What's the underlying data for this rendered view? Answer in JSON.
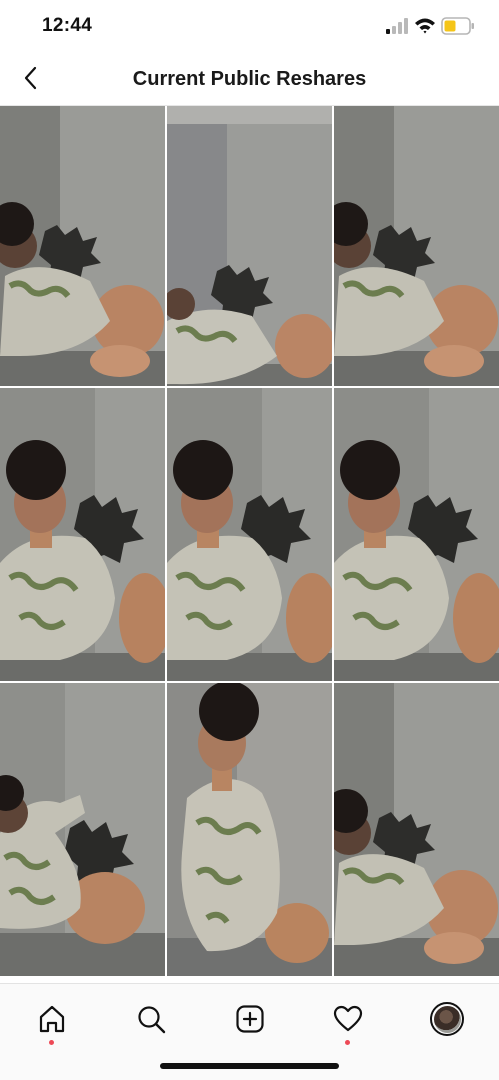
{
  "status_bar": {
    "time": "12:44",
    "battery_color": "#f5c518"
  },
  "header": {
    "title": "Current Public Reshares",
    "back_icon": "chevron-left-icon"
  },
  "grid": {
    "columns": 3,
    "tiles": [
      {
        "label": "reshare-1",
        "pose": "lying"
      },
      {
        "label": "reshare-2",
        "pose": "lying-low"
      },
      {
        "label": "reshare-3",
        "pose": "lying"
      },
      {
        "label": "reshare-4",
        "pose": "sitting"
      },
      {
        "label": "reshare-5",
        "pose": "sitting"
      },
      {
        "label": "reshare-6",
        "pose": "sitting"
      },
      {
        "label": "reshare-7",
        "pose": "arm-up"
      },
      {
        "label": "reshare-8",
        "pose": "kneeling"
      },
      {
        "label": "reshare-9",
        "pose": "lying"
      }
    ]
  },
  "tab_bar": {
    "tabs": [
      {
        "name": "home",
        "icon": "home-icon",
        "has_dot": true
      },
      {
        "name": "search",
        "icon": "search-icon",
        "has_dot": false
      },
      {
        "name": "create",
        "icon": "plus-square-icon",
        "has_dot": false
      },
      {
        "name": "activity",
        "icon": "heart-icon",
        "has_dot": true
      },
      {
        "name": "profile",
        "icon": "avatar",
        "has_dot": false
      }
    ],
    "notification_dot_color": "#ed4956"
  }
}
